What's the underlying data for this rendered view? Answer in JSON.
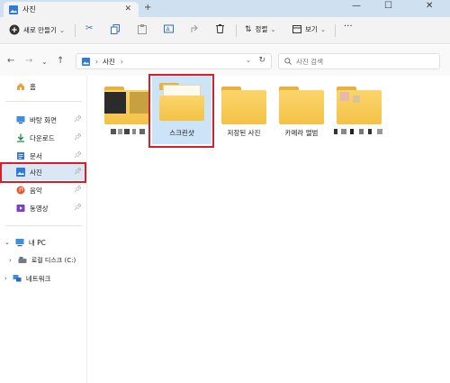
{
  "window": {
    "tab_title": "사진",
    "tab_close": "✕",
    "new_tab": "+",
    "minimize": "—",
    "maximize": "☐",
    "close": "✕"
  },
  "toolbar": {
    "new_label": "새로 만들기",
    "sort_label": "정렬",
    "view_label": "보기",
    "more_label": "···"
  },
  "address": {
    "breadcrumb": "사진",
    "chevron": "›",
    "search_placeholder": "사진 검색"
  },
  "sidebar": {
    "items": [
      {
        "label": "홈",
        "icon": "home-icon",
        "pinned": false
      },
      {
        "label": "바탕 화면",
        "icon": "desktop-icon",
        "pinned": true
      },
      {
        "label": "다운로드",
        "icon": "download-icon",
        "pinned": true
      },
      {
        "label": "문서",
        "icon": "document-icon",
        "pinned": true
      },
      {
        "label": "사진",
        "icon": "pictures-icon",
        "pinned": true,
        "selected": true
      },
      {
        "label": "음악",
        "icon": "music-icon",
        "pinned": true
      },
      {
        "label": "동영상",
        "icon": "video-icon",
        "pinned": true
      },
      {
        "label": "내 PC",
        "icon": "pc-icon",
        "pinned": false
      },
      {
        "label": "로컬 디스크 (C:)",
        "icon": "drive-icon",
        "pinned": false
      },
      {
        "label": "네트워크",
        "icon": "network-icon",
        "pinned": false
      }
    ]
  },
  "folders": [
    {
      "label": "",
      "obscured": true
    },
    {
      "label": "스크린샷",
      "selected": true
    },
    {
      "label": "저장된 사진"
    },
    {
      "label": "카메라 앨범"
    },
    {
      "label": "",
      "obscured": true
    }
  ],
  "colors": {
    "accent": "#0067c0",
    "highlight_box": "#d4202a",
    "folder_yellow": "#f3c248",
    "selection_bg": "#cce4f7"
  }
}
